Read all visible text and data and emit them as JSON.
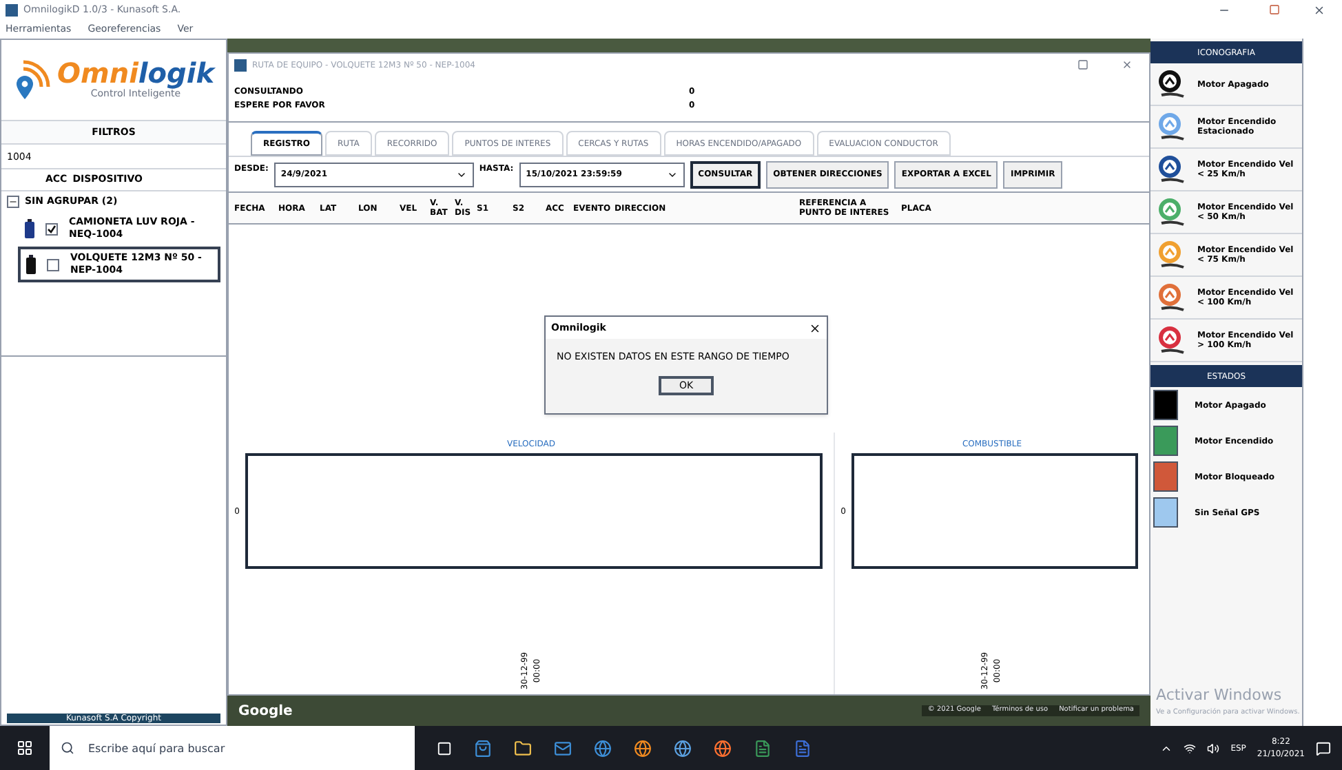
{
  "window": {
    "title": "OmnilogikD 1.0/3 - Kunasoft S.A."
  },
  "menu": [
    "Herramientas",
    "Georeferencias",
    "Ver"
  ],
  "sidebar": {
    "logo": {
      "part_1": "Omni",
      "part_2": "logik",
      "tagline": "Control Inteligente"
    },
    "filters_title": "FILTROS",
    "filter": {
      "value": "1004"
    },
    "columns": [
      "ACC",
      "DISPOSITIVO"
    ],
    "tree": [
      {
        "label": "SIN AGRUPAR (2)",
        "expanded": true,
        "children": [
          {
            "label": "CAMIONETA LUV ROJA - NEQ-1004",
            "checked": true,
            "selected": false
          },
          {
            "label": "VOLQUETE 12M3 Nº 50 - NEP-1004",
            "checked": false,
            "selected": true
          }
        ]
      }
    ],
    "footer": "Kunasoft S.A Copyright"
  },
  "dialog": {
    "title": "RUTA DE EQUIPO - VOLQUETE 12M3 Nº 50 - NEP-1004",
    "status": [
      {
        "label": "CONSULTANDO",
        "value": "0"
      },
      {
        "label": "ESPERE POR FAVOR",
        "value": "0"
      }
    ],
    "tabs": [
      {
        "label": "REGISTRO",
        "selected": true,
        "disabled": false
      },
      {
        "label": "RUTA",
        "selected": false,
        "disabled": true
      },
      {
        "label": "RECORRIDO",
        "selected": false,
        "disabled": true
      },
      {
        "label": "PUNTOS DE INTERES",
        "selected": false,
        "disabled": true
      },
      {
        "label": "CERCAS Y RUTAS",
        "selected": false,
        "disabled": true
      },
      {
        "label": "HORAS ENCENDIDO/APAGADO",
        "selected": false,
        "disabled": true
      },
      {
        "label": "EVALUACION CONDUCTOR",
        "selected": false,
        "disabled": true
      }
    ],
    "from": {
      "label": "DESDE:",
      "value": "24/9/2021"
    },
    "to": {
      "label": "HASTA:",
      "value": "15/10/2021 23:59:59"
    },
    "buttons": [
      {
        "label": "CONSULTAR",
        "focused": true
      },
      {
        "label": "OBTENER DIRECCIONES",
        "focused": false
      },
      {
        "label": "EXPORTAR A EXCEL",
        "focused": false
      },
      {
        "label": "IMPRIMIR",
        "focused": false
      }
    ],
    "table": {
      "columns": [
        "FECHA",
        "HORA",
        "LAT",
        "LON",
        "VEL",
        "V. BAT",
        "V. DIS",
        "S1",
        "S2",
        "ACC",
        "EVENTO",
        "DIRECCION",
        "REFERENCIA A PUNTO DE INTERES",
        "PLACA"
      ]
    },
    "message": {
      "title": "Omnilogik",
      "text": "NO EXISTEN DATOS EN ESTE RANGO DE TIEMPO",
      "button": "OK"
    },
    "charts": [
      {
        "title": "VELOCIDAD",
        "ytick": "0",
        "xtick_date": "30-12-99",
        "xtick_time": "00:00"
      },
      {
        "title": "COMBUSTIBLE",
        "ytick": "0",
        "xtick_date": "30-12-99",
        "xtick_time": "00:00"
      }
    ]
  },
  "map": {
    "logo": "Google",
    "footer": [
      "© 2021 Google",
      "Términos de uso",
      "Notificar un problema"
    ]
  },
  "legend": {
    "icons_title": "ICONOGRAFIA",
    "icons": [
      {
        "label": "Motor Apagado",
        "color": "#111111"
      },
      {
        "label": "Motor Encendido Estacionado",
        "color": "#6fa8e8"
      },
      {
        "label": "Motor Encendido Vel < 25 Km/h",
        "color": "#1f4f9a"
      },
      {
        "label": "Motor Encendido Vel < 50 Km/h",
        "color": "#4caf6a"
      },
      {
        "label": "Motor Encendido Vel < 75 Km/h",
        "color": "#f0a030"
      },
      {
        "label": "Motor Encendido Vel < 100 Km/h",
        "color": "#e0703a"
      },
      {
        "label": "Motor Encendido Vel > 100 Km/h",
        "color": "#d83040"
      }
    ],
    "states_title": "ESTADOS",
    "states": [
      {
        "label": "Motor Apagado",
        "color": "#000000"
      },
      {
        "label": "Motor Encendido",
        "color": "#3a9a5a"
      },
      {
        "label": "Motor Bloqueado",
        "color": "#d0583a"
      },
      {
        "label": "Sin Señal GPS",
        "color": "#9ec8ee"
      }
    ]
  },
  "activation": {
    "title": "Activar Windows",
    "text": "Ve a Configuración para activar Windows."
  },
  "taskbar": {
    "search": {
      "placeholder": "Escribe aquí para buscar"
    },
    "language": "ESP",
    "time": "8:22",
    "date": "21/10/2021"
  }
}
